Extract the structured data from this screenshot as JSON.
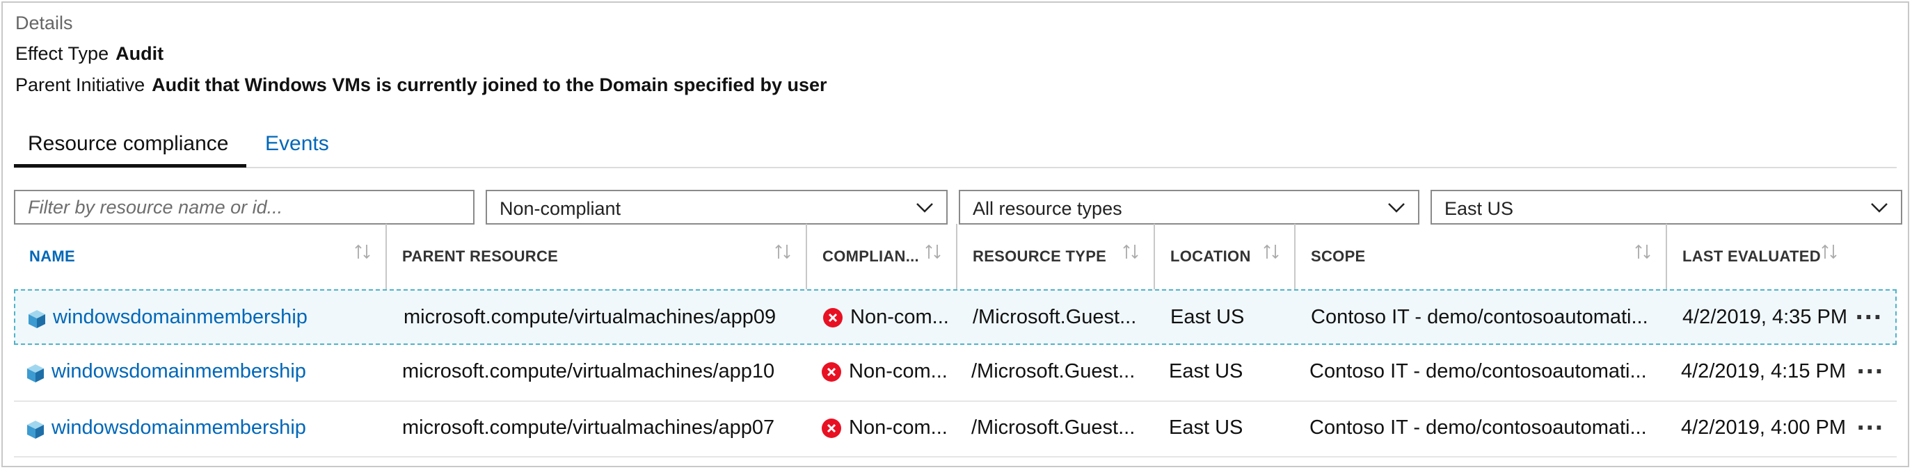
{
  "details": {
    "title": "Details",
    "effect_label": "Effect Type",
    "effect_value": "Audit",
    "parent_label": "Parent Initiative",
    "parent_value": "Audit that Windows VMs is currently joined to the Domain specified by user"
  },
  "tabs": [
    {
      "label": "Resource compliance",
      "active": true
    },
    {
      "label": "Events",
      "active": false
    }
  ],
  "filters": {
    "search_placeholder": "Filter by resource name or id...",
    "compliance": "Non-compliant",
    "resource_types": "All resource types",
    "location": "East US"
  },
  "columns": [
    "NAME",
    "PARENT RESOURCE",
    "COMPLIAN...",
    "RESOURCE TYPE",
    "LOCATION",
    "SCOPE",
    "LAST EVALUATED"
  ],
  "rows": [
    {
      "name": "windowsdomainmembership",
      "parent": "microsoft.compute/virtualmachines/app09",
      "compliance": "Non-com...",
      "type": "/Microsoft.Guest...",
      "location": "East US",
      "scope": "Contoso IT - demo/contosoautomati...",
      "evaluated": "4/2/2019, 4:35 PM",
      "more": "..."
    },
    {
      "name": "windowsdomainmembership",
      "parent": "microsoft.compute/virtualmachines/app10",
      "compliance": "Non-com...",
      "type": "/Microsoft.Guest...",
      "location": "East US",
      "scope": "Contoso IT - demo/contosoautomati...",
      "evaluated": "4/2/2019, 4:15 PM",
      "more": "..."
    },
    {
      "name": "windowsdomainmembership",
      "parent": "microsoft.compute/virtualmachines/app07",
      "compliance": "Non-com...",
      "type": "/Microsoft.Guest...",
      "location": "East US",
      "scope": "Contoso IT - demo/contosoautomati...",
      "evaluated": "4/2/2019, 4:00 PM",
      "more": "..."
    }
  ],
  "colors": {
    "link": "#0067b8",
    "error": "#e81123",
    "selected_bg": "#f0f8fb",
    "selected_border": "#4fb3c9"
  },
  "icons": {
    "resource": "cube-icon",
    "status": "error-circle-icon",
    "sort": "sort-arrows-icon",
    "dropdown": "chevron-down-icon"
  }
}
